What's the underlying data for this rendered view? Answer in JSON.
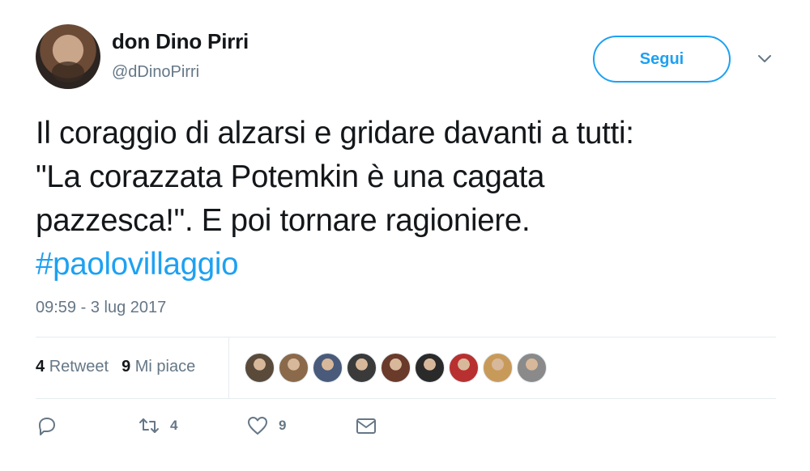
{
  "author": {
    "display_name": "don Dino Pirri",
    "handle": "@dDinoPirri",
    "avatar_icon": "avatar-photo"
  },
  "follow_button": {
    "label": "Segui"
  },
  "menu": {
    "icon": "chevron-down-icon"
  },
  "tweet": {
    "lines": [
      "Il coraggio di alzarsi e gridare davanti a tutti:",
      "\"La corazzata Potemkin è una cagata",
      "pazzesca!\". E poi tornare ragioniere."
    ],
    "hashtag": "#paolovillaggio",
    "timestamp": "09:59 - 3 lug 2017"
  },
  "stats": {
    "retweet_count": "4",
    "retweet_label": "Retweet",
    "like_count": "9",
    "like_label": "Mi piace"
  },
  "likers": [
    {
      "color": "#5a4a3a"
    },
    {
      "color": "#8a6a4a"
    },
    {
      "color": "#4a5a7a"
    },
    {
      "color": "#3a3a3a"
    },
    {
      "color": "#6a3a2a"
    },
    {
      "color": "#2a2a2a"
    },
    {
      "color": "#b83030"
    },
    {
      "color": "#c89a5a"
    },
    {
      "color": "#8a8a8a"
    }
  ],
  "actions": {
    "reply_icon": "reply-icon",
    "retweet_icon": "retweet-icon",
    "retweet_count": "4",
    "like_icon": "heart-icon",
    "like_count": "9",
    "dm_icon": "envelope-icon"
  },
  "colors": {
    "accent": "#1da1f2",
    "secondary_text": "#657786",
    "divider": "#e6ecf0"
  }
}
